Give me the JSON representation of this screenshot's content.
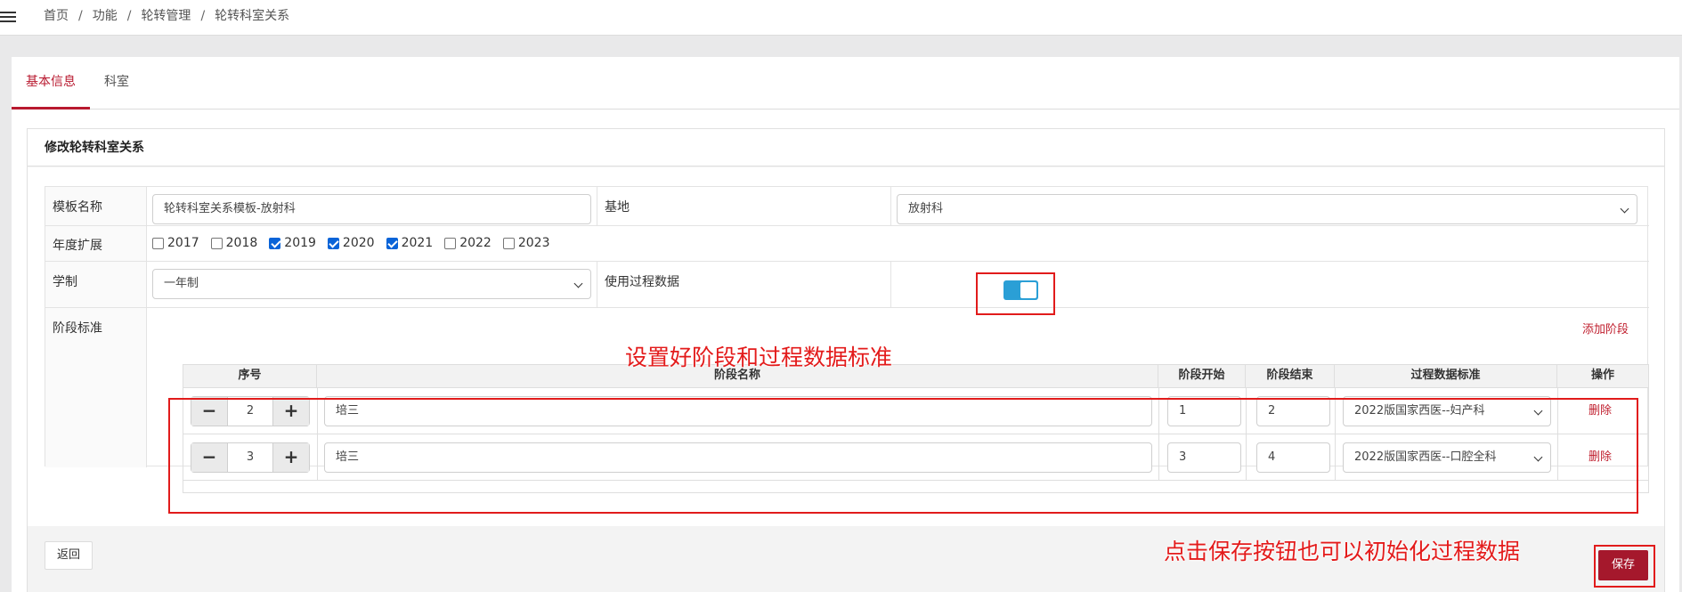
{
  "breadcrumb": [
    "首页",
    "功能",
    "轮转管理",
    "轮转科室关系"
  ],
  "tabs": [
    {
      "label": "基本信息",
      "active": true
    },
    {
      "label": "科室",
      "active": false
    }
  ],
  "panel": {
    "title": "修改轮转科室关系"
  },
  "form": {
    "template_name_label": "模板名称",
    "template_name_value": "轮转科室关系模板-放射科",
    "base_label": "基地",
    "base_value": "放射科",
    "year_ext_label": "年度扩展",
    "years": [
      {
        "label": "2017",
        "checked": false
      },
      {
        "label": "2018",
        "checked": false
      },
      {
        "label": "2019",
        "checked": true
      },
      {
        "label": "2020",
        "checked": true
      },
      {
        "label": "2021",
        "checked": true
      },
      {
        "label": "2022",
        "checked": false
      },
      {
        "label": "2023",
        "checked": false
      }
    ],
    "system_label": "学制",
    "system_value": "一年制",
    "use_process_label": "使用过程数据",
    "use_process_on": true,
    "stage_label": "阶段标准",
    "add_stage": "添加阶段"
  },
  "stage_table": {
    "headers": [
      "序号",
      "阶段名称",
      "阶段开始",
      "阶段结束",
      "过程数据标准",
      "操作"
    ],
    "rows": [
      {
        "seq": "2",
        "name": "培三",
        "start": "1",
        "end": "2",
        "standard": "2022版国家西医--妇产科",
        "action": "删除"
      },
      {
        "seq": "3",
        "name": "培三",
        "start": "3",
        "end": "4",
        "standard": "2022版国家西医--口腔全科",
        "action": "删除"
      }
    ]
  },
  "buttons": {
    "back": "返回",
    "save": "保存"
  },
  "annotations": {
    "stage_note": "设置好阶段和过程数据标准",
    "save_note": "点击保存按钮也可以初始化过程数据"
  },
  "colors": {
    "accent": "#b8192f",
    "annotation": "#e31b1b",
    "toggle": "#2a9fd6",
    "checkbox": "#0a64d8"
  }
}
